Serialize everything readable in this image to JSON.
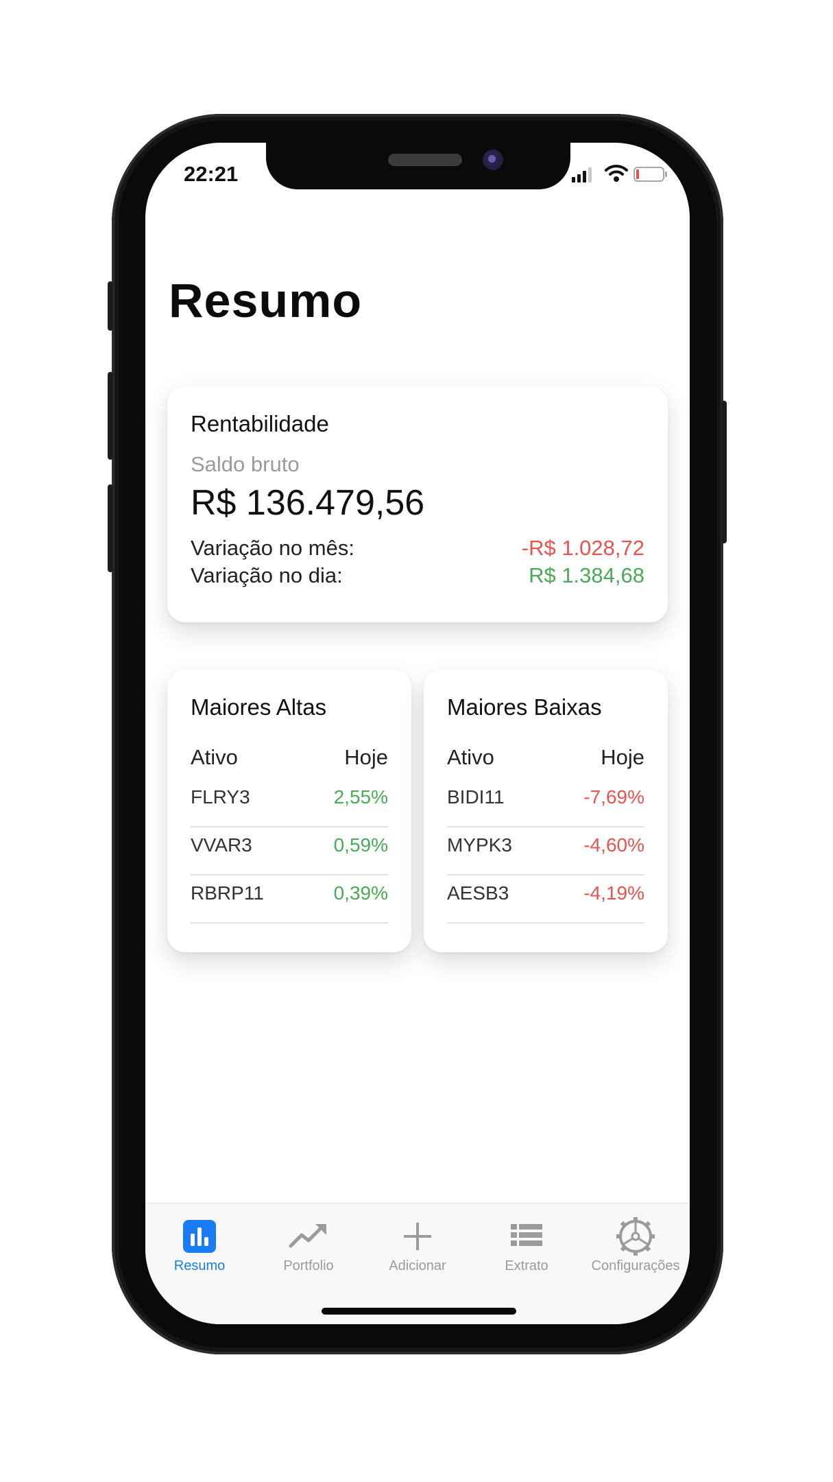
{
  "status_bar": {
    "time": "22:21",
    "icons": [
      "cellular-signal-icon",
      "wifi-icon",
      "battery-low-icon"
    ]
  },
  "page": {
    "title": "Resumo"
  },
  "summary_card": {
    "title": "Rentabilidade",
    "gross_balance_label": "Saldo bruto",
    "gross_balance_value": "R$ 136.479,56",
    "month_variation_label": "Variação no mês:",
    "month_variation_value": "-R$ 1.028,72",
    "day_variation_label": "Variação no dia:",
    "day_variation_value": "R$ 1.384,68"
  },
  "top_gainers": {
    "title": "Maiores Altas",
    "col_asset": "Ativo",
    "col_today": "Hoje",
    "rows": [
      {
        "asset": "FLRY3",
        "change": "2,55%"
      },
      {
        "asset": "VVAR3",
        "change": "0,59%"
      },
      {
        "asset": "RBRP11",
        "change": "0,39%"
      }
    ]
  },
  "top_losers": {
    "title": "Maiores Baixas",
    "col_asset": "Ativo",
    "col_today": "Hoje",
    "rows": [
      {
        "asset": "BIDI11",
        "change": "-7,69%"
      },
      {
        "asset": "MYPK3",
        "change": "-4,60%"
      },
      {
        "asset": "AESB3",
        "change": "-4,19%"
      }
    ]
  },
  "tab_bar": {
    "active": "Resumo",
    "items": [
      {
        "label": "Resumo",
        "icon": "bar-chart-icon"
      },
      {
        "label": "Portfolio",
        "icon": "trending-up-icon"
      },
      {
        "label": "Adicionar",
        "icon": "plus-icon"
      },
      {
        "label": "Extrato",
        "icon": "list-icon"
      },
      {
        "label": "Configurações",
        "icon": "gear-icon"
      }
    ]
  },
  "colors": {
    "positive": "#4aaa57",
    "negative": "#e8534e",
    "accent": "#1a7cf4",
    "inactive_tab": "#9b9b9b"
  }
}
